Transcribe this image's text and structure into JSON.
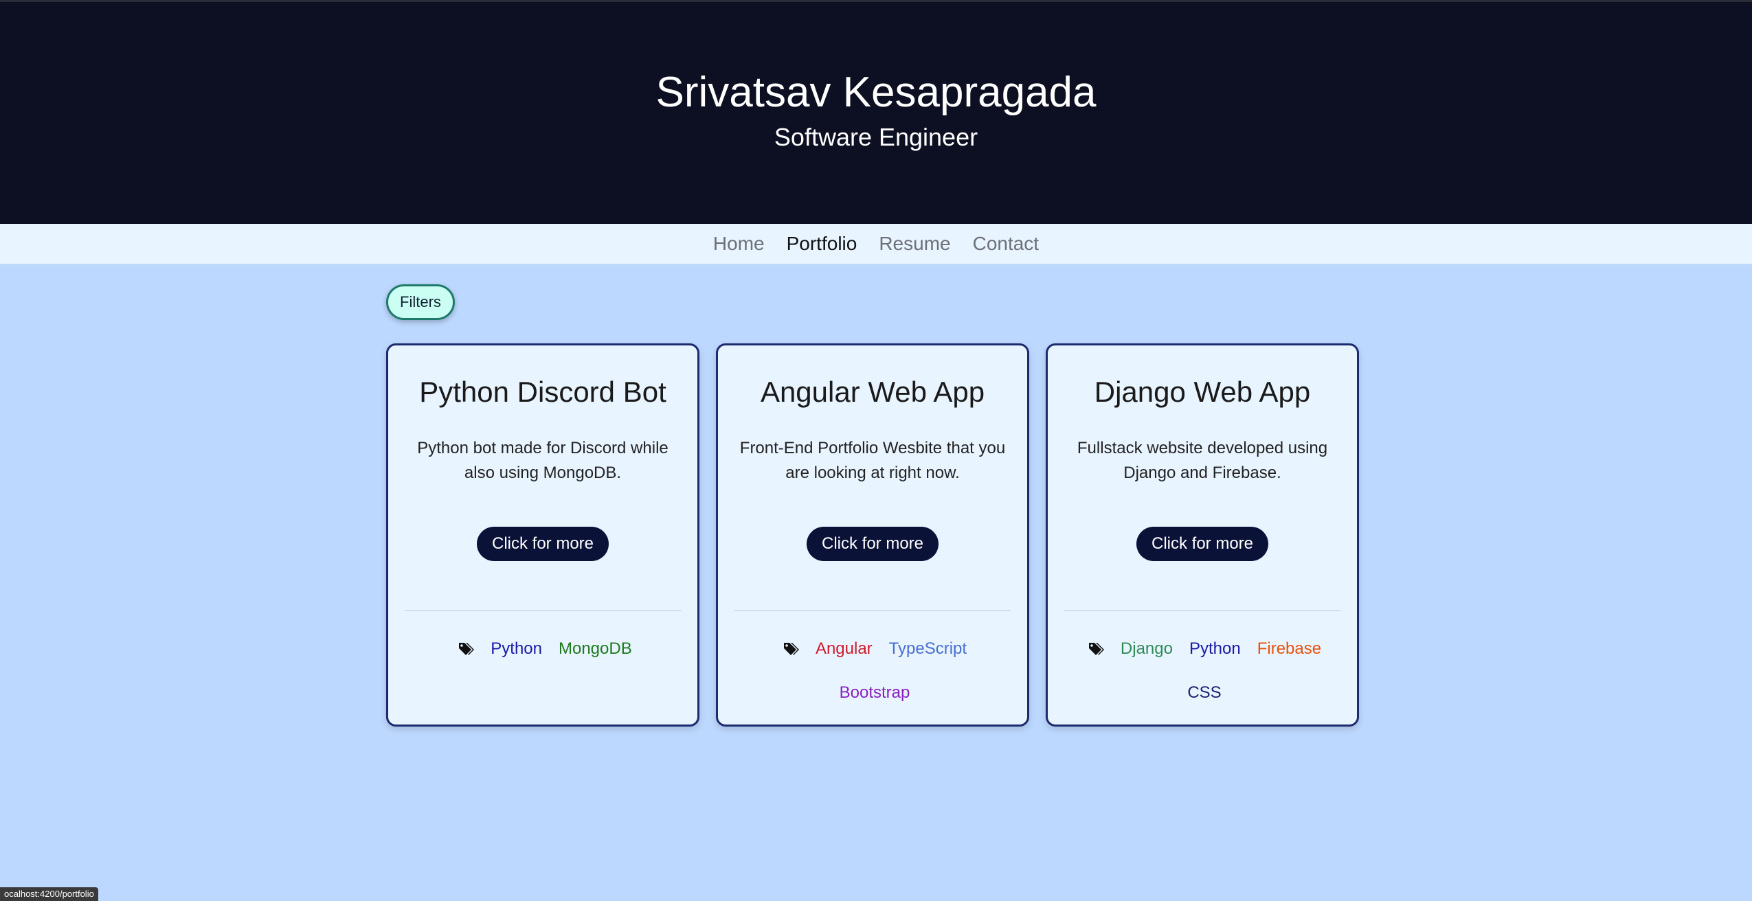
{
  "header": {
    "name": "Srivatsav Kesapragada",
    "title": "Software Engineer"
  },
  "nav": {
    "items": [
      {
        "label": "Home"
      },
      {
        "label": "Portfolio",
        "active": true
      },
      {
        "label": "Resume"
      },
      {
        "label": "Contact"
      }
    ]
  },
  "filters": {
    "label": "Filters"
  },
  "cards": [
    {
      "title": "Python Discord Bot",
      "description": "Python bot made for Discord while also using MongoDB.",
      "button": "Click for more",
      "tags": [
        {
          "label": "Python",
          "color": "#1a1aa8"
        },
        {
          "label": "MongoDB",
          "color": "#1f7a1f"
        }
      ]
    },
    {
      "title": "Angular Web App",
      "description": "Front-End Portfolio Wesbite that you are looking at right now.",
      "button": "Click for more",
      "tags": [
        {
          "label": "Angular",
          "color": "#d11a2a"
        },
        {
          "label": "TypeScript",
          "color": "#4a6fd1"
        },
        {
          "label": "Bootstrap",
          "color": "#8a1fc0"
        }
      ]
    },
    {
      "title": "Django Web App",
      "description": "Fullstack website developed using Django and Firebase.",
      "button": "Click for more",
      "tags": [
        {
          "label": "Django",
          "color": "#2e8b57"
        },
        {
          "label": "Python",
          "color": "#1a1aa8"
        },
        {
          "label": "Firebase",
          "color": "#e8520a"
        },
        {
          "label": "CSS",
          "color": "#1a2370"
        }
      ]
    }
  ],
  "status_bar": {
    "url": "ocalhost:4200/portfolio"
  },
  "icons": {
    "tag": "tags-icon"
  }
}
